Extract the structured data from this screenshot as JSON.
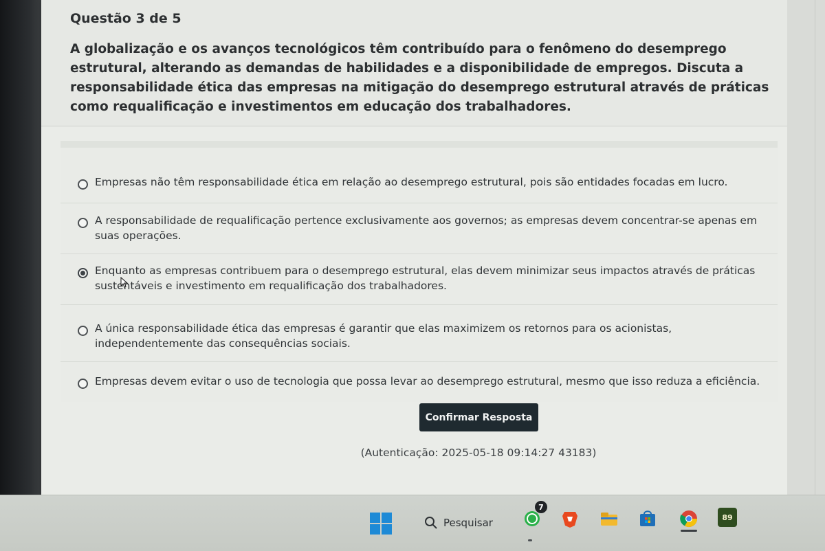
{
  "question": {
    "number_label": "Questão 3 de 5",
    "text": "A globalização e os avanços tecnológicos têm contribuído para o fenômeno do desemprego estrutural, alterando as demandas de habilidades e a disponibilidade de empregos. Discuta a responsabilidade ética das empresas na mitigação do desemprego estrutural através de práticas como requalificação e investimentos em educação dos trabalhadores."
  },
  "options": [
    {
      "label": "Empresas não têm responsabilidade ética em relação ao desemprego estrutural, pois são entidades focadas em lucro.",
      "selected": false
    },
    {
      "label": "A responsabilidade de requalificação pertence exclusivamente aos governos; as empresas devem concentrar-se apenas em suas operações.",
      "selected": false
    },
    {
      "label": "Enquanto as empresas contribuem para o desemprego estrutural, elas devem minimizar seus impactos através de práticas sustentáveis e investimento em requalificação dos trabalhadores.",
      "selected": true
    },
    {
      "label": "A única responsabilidade ética das empresas é garantir que elas maximizem os retornos para os acionistas, independentemente das consequências sociais.",
      "selected": false
    },
    {
      "label": "Empresas devem evitar o uso de tecnologia que possa levar ao desemprego estrutural, mesmo que isso reduza a eficiência.",
      "selected": false
    }
  ],
  "confirm_label": "Confirmar Resposta",
  "auth_text": "(Autenticação: 2025-05-18 09:14:27 43183)",
  "taskbar": {
    "search_label": "Pesquisar",
    "whatsapp_badge": "7",
    "weather_temp": "89"
  },
  "colors": {
    "accent_button": "#1f2a30",
    "windows_blue": "#1e8ad6"
  }
}
